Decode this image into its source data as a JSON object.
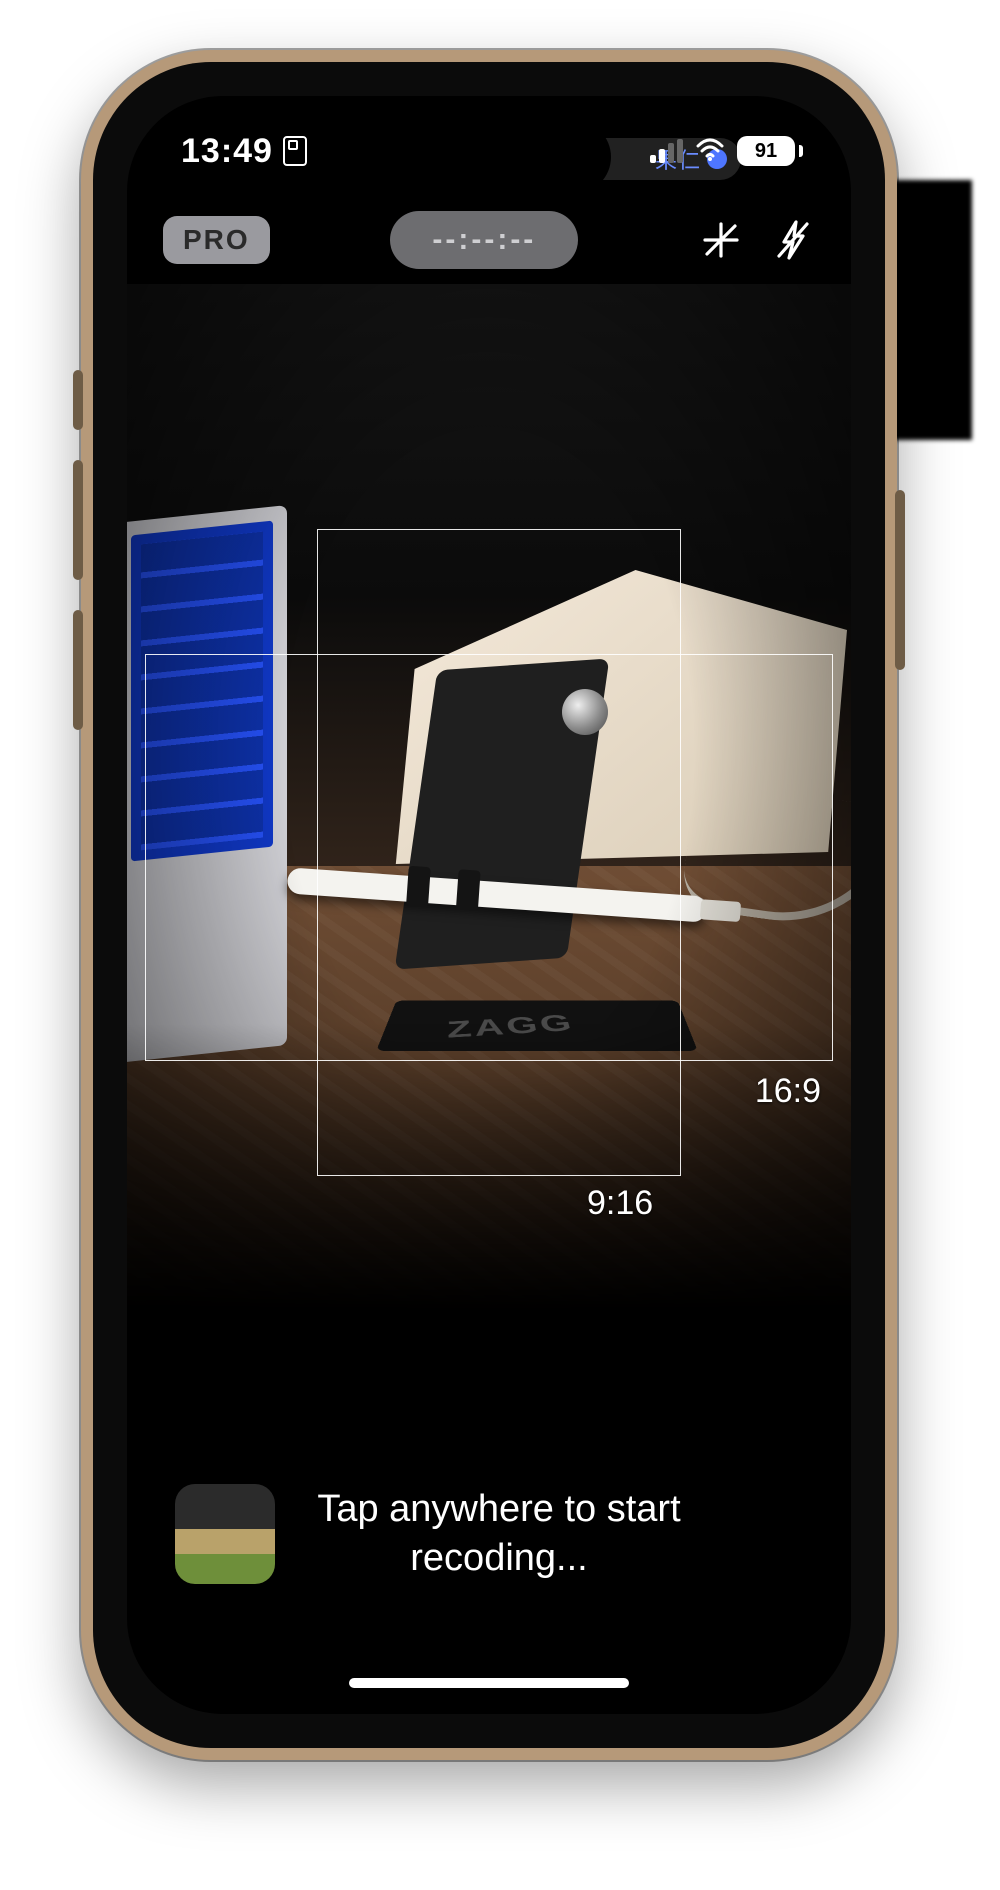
{
  "status_bar": {
    "time": "13:49",
    "battery_percent": "91",
    "island_text": "果仁"
  },
  "app_bar": {
    "pro_label": "PRO",
    "timer": "--:--:--",
    "icons": {
      "focus": "focus-off-icon",
      "flash": "flash-off-icon"
    }
  },
  "viewfinder": {
    "frame_labels": {
      "wide": "16:9",
      "tall": "9:16"
    },
    "scene_brand": "ZAGG"
  },
  "footer": {
    "hint": "Tap anywhere to start recoding..."
  }
}
